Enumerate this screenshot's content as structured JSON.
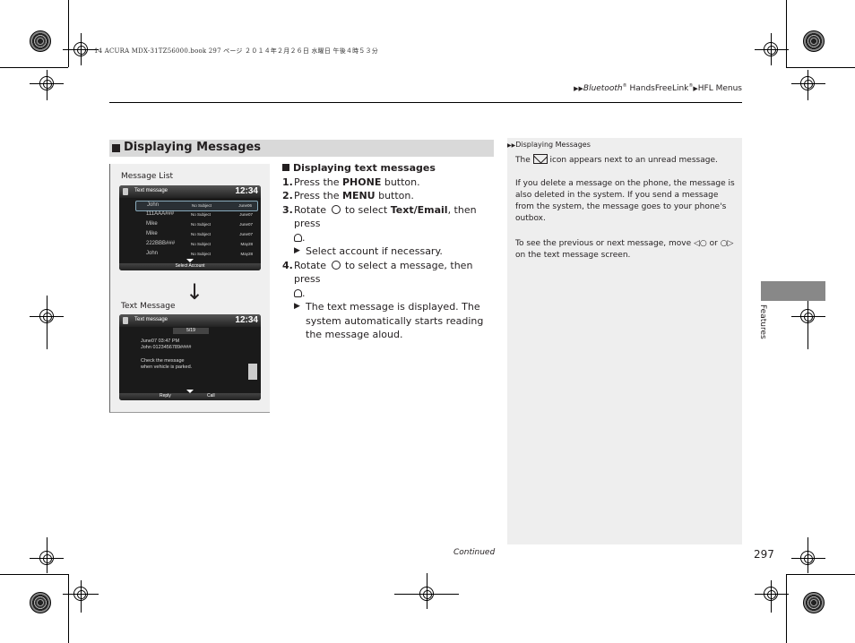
{
  "print_header": "14 ACURA MDX-31TZ56000.book  297 ページ  ２０１４年２月２６日  水曜日  午後４時５３分",
  "breadcrumb": {
    "items": [
      "Bluetooth",
      "HandsFreeLink",
      "HFL Menus"
    ],
    "separator_icon": "double-triangle"
  },
  "section": {
    "title": "Displaying Messages"
  },
  "figure": {
    "label_list": "Message List",
    "label_message": "Text Message",
    "screen1": {
      "title": "Text message",
      "clock": "12:34",
      "rows": [
        {
          "name": "John",
          "subject": "No Subject",
          "date": "June06",
          "selected": true
        },
        {
          "name": "111AAA###",
          "subject": "No Subject",
          "date": "June07"
        },
        {
          "name": "Mike",
          "subject": "No Subject",
          "date": "June07"
        },
        {
          "name": "Mike",
          "subject": "No Subject",
          "date": "June07"
        },
        {
          "name": "222BBB###",
          "subject": "No Subject",
          "date": "May28"
        },
        {
          "name": "John",
          "subject": "No Subject",
          "date": "May28"
        }
      ],
      "bottom_label": "Select Account"
    },
    "screen2": {
      "title": "Text message",
      "clock": "12:34",
      "counter": "5/19",
      "line1": "June07 03:47 PM",
      "line2": "John 0123456789####",
      "line3": "Check the message",
      "line4": "when vehicle is parked.",
      "btn_reply": "Reply",
      "btn_call": "Call"
    }
  },
  "steps": {
    "subheading": "Displaying text messages",
    "s1_num": "1.",
    "s1_pre": "Press the ",
    "s1_bold": "PHONE",
    "s1_post": " button.",
    "s2_num": "2.",
    "s2_pre": "Press the ",
    "s2_bold": "MENU",
    "s2_post": " button.",
    "s3_num": "3.",
    "s3_pre": "Rotate ",
    "s3_mid": " to select ",
    "s3_bold": "Text/Email",
    "s3_post": ", then press",
    "s3_sub": "Select account if necessary.",
    "s4_num": "4.",
    "s4_pre": "Rotate ",
    "s4_post": " to select a message, then press",
    "s4_sub": "The text message is displayed. The system automatically starts reading the message aloud."
  },
  "notes": {
    "heading": "Displaying Messages",
    "p1_pre": "The ",
    "p1_post": " icon appears next to an unread message.",
    "p2": "If you delete a message on the phone, the message is also deleted in the system. If you send a message from the system, the message goes to your phone's outbox.",
    "p3_pre": "To see the previous or next message, move ",
    "p3_mid": " or ",
    "p3_post": " on the text message screen."
  },
  "side_tab_label": "Features",
  "continued": "Continued",
  "page_number": "297"
}
